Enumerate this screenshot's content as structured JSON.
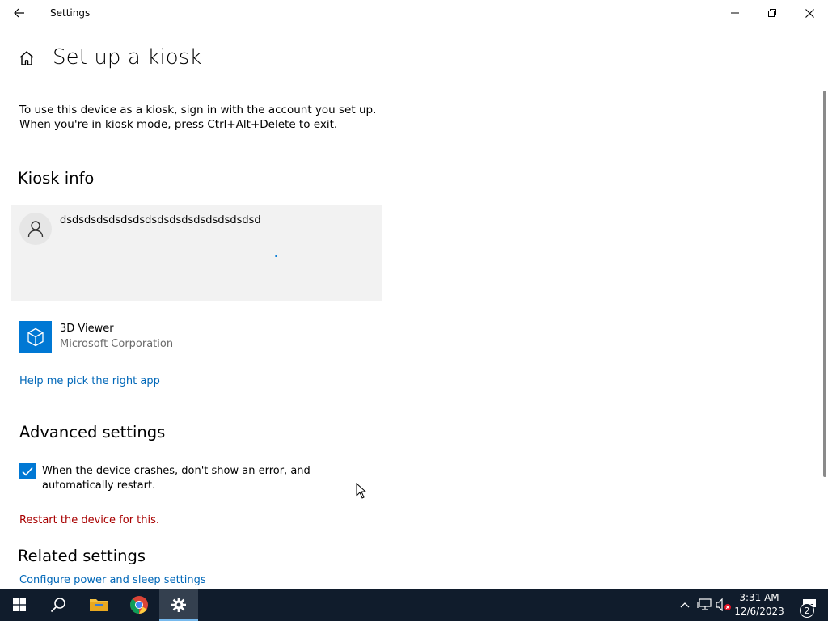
{
  "window": {
    "title": "Settings",
    "back_icon": "back-arrow-icon",
    "controls": [
      "minimize-icon",
      "restore-icon",
      "close-icon"
    ]
  },
  "page": {
    "title": "Set up a kiosk",
    "home_icon": "home-icon",
    "description": "To use this device as a kiosk, sign in with the account you set up. When you're in kiosk mode, press Ctrl+Alt+Delete to exit."
  },
  "kiosk_info": {
    "heading": "Kiosk info",
    "account": {
      "name": "dsdsdsdsdsdsdsdsdsdsdsdsdsdsdsdsd",
      "icon": "person-icon",
      "loading": true
    },
    "app": {
      "name": "3D Viewer",
      "publisher": "Microsoft Corporation",
      "icon": "cube-icon",
      "tile_color": "#0078d4"
    },
    "help_link": "Help me pick the right app"
  },
  "advanced": {
    "heading": "Advanced settings",
    "crash_option": {
      "checked": true,
      "label": "When the device crashes, don't show an error, and automatically restart."
    },
    "restart_notice": "Restart the device for this."
  },
  "related": {
    "heading": "Related settings",
    "power_link": "Configure power and sleep settings"
  },
  "taskbar": {
    "apps": [
      "windows-start-icon",
      "search-icon",
      "file-explorer-icon",
      "chrome-icon",
      "settings-gear-icon"
    ],
    "active_app": "Settings",
    "tray": [
      "chevron-up-icon",
      "network-icon",
      "volume-muted-icon"
    ],
    "time": "3:31 AM",
    "date": "12/6/2023",
    "notifications": "2"
  },
  "colors": {
    "accent": "#0078d4",
    "link": "#0067b8",
    "warning": "#a80000",
    "taskbar": "#101c2c"
  }
}
